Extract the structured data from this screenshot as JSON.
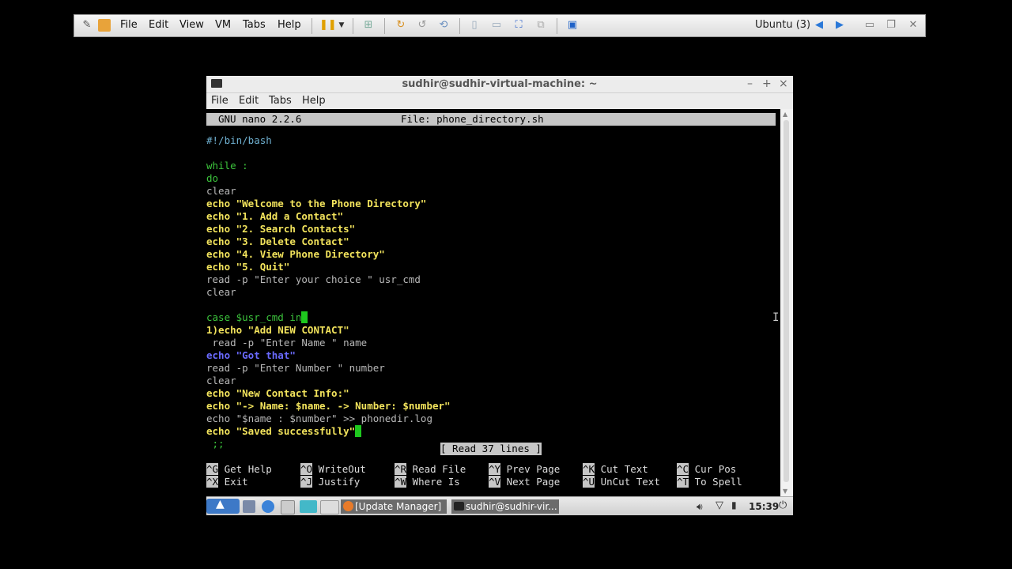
{
  "vmware": {
    "menu": [
      "File",
      "Edit",
      "View",
      "VM",
      "Tabs",
      "Help"
    ],
    "vm_name": "Ubuntu (3)"
  },
  "window": {
    "title": "sudhir@sudhir-virtual-machine: ~",
    "menu": [
      "File",
      "Edit",
      "Tabs",
      "Help"
    ],
    "controls": [
      "–",
      "+",
      "×"
    ]
  },
  "nano": {
    "header_left": "GNU nano 2.2.6",
    "header_file": "File: phone_directory.sh",
    "status": "[ Read 37 lines ]",
    "shortcuts": [
      {
        "key": "^G",
        "label": "Get Help"
      },
      {
        "key": "^O",
        "label": "WriteOut"
      },
      {
        "key": "^R",
        "label": "Read File"
      },
      {
        "key": "^Y",
        "label": "Prev Page"
      },
      {
        "key": "^K",
        "label": "Cut Text"
      },
      {
        "key": "^C",
        "label": "Cur Pos"
      },
      {
        "key": "^X",
        "label": "Exit"
      },
      {
        "key": "^J",
        "label": "Justify"
      },
      {
        "key": "^W",
        "label": "Where Is"
      },
      {
        "key": "^V",
        "label": "Next Page"
      },
      {
        "key": "^U",
        "label": "UnCut Text"
      },
      {
        "key": "^T",
        "label": "To Spell"
      }
    ],
    "lines": [
      "#!/bin/bash",
      "",
      "while :",
      "do",
      "clear",
      "echo \"Welcome to the Phone Directory\"",
      "echo \"1. Add a Contact\"",
      "echo \"2. Search Contacts\"",
      "echo \"3. Delete Contact\"",
      "echo \"4. View Phone Directory\"",
      "echo \"5. Quit\"",
      "read -p \"Enter your choice \" usr_cmd",
      "clear",
      "",
      "case $usr_cmd in",
      "1)echo \"Add NEW CONTACT\"",
      " read -p \"Enter Name \" name",
      "echo \"Got that\"",
      "read -p \"Enter Number \" number",
      "clear",
      "echo \"New Contact Info:\"",
      "echo \"-> Name: $name. -> Number: $number\"",
      "echo \"$name : $number\" >> phonedir.log",
      "echo \"Saved successfully\"",
      " ;;"
    ]
  },
  "taskbar": {
    "items": [
      "[Update Manager]",
      "sudhir@sudhir-vir..."
    ],
    "clock": "15:39"
  }
}
